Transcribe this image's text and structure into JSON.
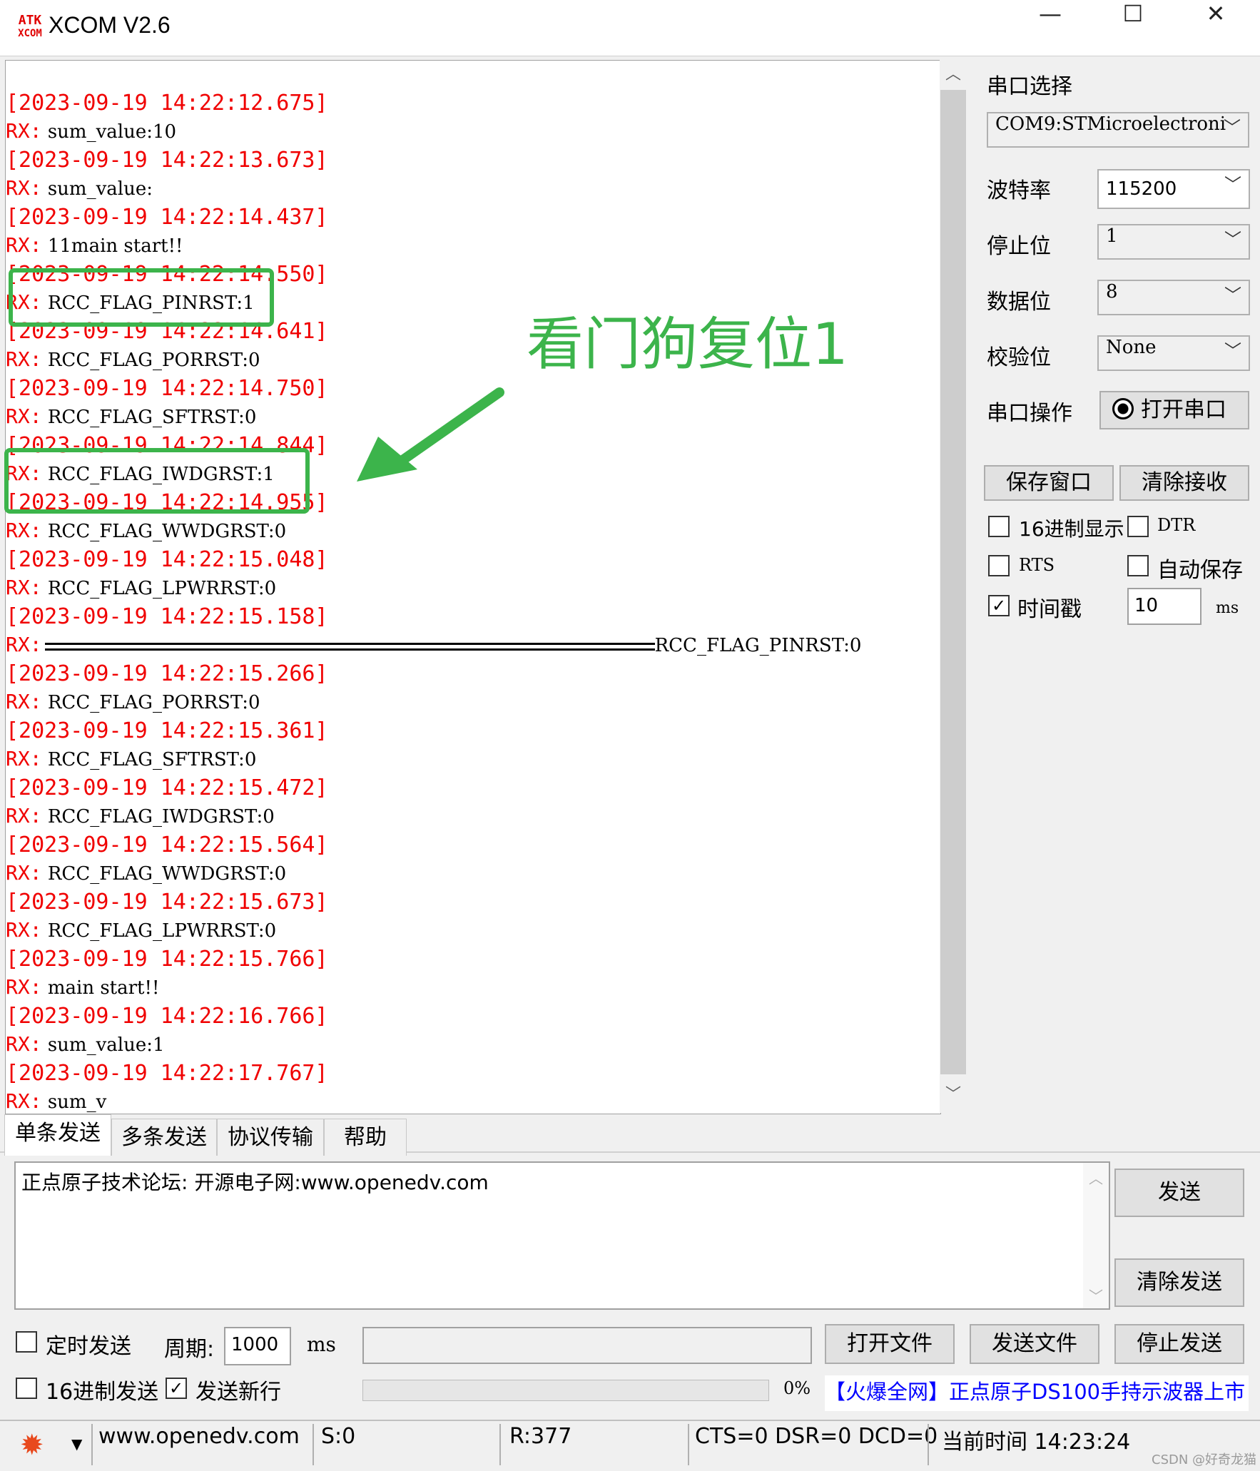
{
  "window": {
    "logo_top": "ATK",
    "logo_bottom": "XCOM",
    "title": "XCOM V2.6",
    "minimize_glyph": "—",
    "maximize_glyph": "☐",
    "close_glyph": "✕"
  },
  "receive": {
    "lines": [
      {
        "timestamp": "[2023-09-19 14:22:12.675]",
        "tag": "RX:",
        "text": " sum_value:10"
      },
      {
        "timestamp": "[2023-09-19 14:22:13.673]",
        "tag": "RX:",
        "text": " sum_value:"
      },
      {
        "timestamp": "[2023-09-19 14:22:14.437]",
        "tag": "RX:",
        "text": " 11main start!!"
      },
      {
        "timestamp": "[2023-09-19 14:22:14.550]",
        "tag": "RX:",
        "text": " RCC_FLAG_PINRST:1"
      },
      {
        "timestamp": "[2023-09-19 14:22:14.641]",
        "tag": "RX:",
        "text": " RCC_FLAG_PORRST:0"
      },
      {
        "timestamp": "[2023-09-19 14:22:14.750]",
        "tag": "RX:",
        "text": " RCC_FLAG_SFTRST:0"
      },
      {
        "timestamp": "[2023-09-19 14:22:14.844]",
        "tag": "RX:",
        "text": " RCC_FLAG_IWDGRST:1"
      },
      {
        "timestamp": "[2023-09-19 14:22:14.955]",
        "tag": "RX:",
        "text": " RCC_FLAG_WWDGRST:0"
      },
      {
        "timestamp": "[2023-09-19 14:22:15.048]",
        "tag": "RX:",
        "text": " RCC_FLAG_LPWRRST:0"
      },
      {
        "timestamp": "[2023-09-19 14:22:15.158]",
        "tag": "RX:",
        "text": "RCC_FLAG_PINRST:0",
        "separator": true
      },
      {
        "timestamp": "[2023-09-19 14:22:15.266]",
        "tag": "RX:",
        "text": " RCC_FLAG_PORRST:0"
      },
      {
        "timestamp": "[2023-09-19 14:22:15.361]",
        "tag": "RX:",
        "text": " RCC_FLAG_SFTRST:0"
      },
      {
        "timestamp": "[2023-09-19 14:22:15.472]",
        "tag": "RX:",
        "text": " RCC_FLAG_IWDGRST:0"
      },
      {
        "timestamp": "[2023-09-19 14:22:15.564]",
        "tag": "RX:",
        "text": " RCC_FLAG_WWDGRST:0"
      },
      {
        "timestamp": "[2023-09-19 14:22:15.673]",
        "tag": "RX:",
        "text": " RCC_FLAG_LPWRRST:0"
      },
      {
        "timestamp": "[2023-09-19 14:22:15.766]",
        "tag": "RX:",
        "text": " main start!!"
      },
      {
        "timestamp": "[2023-09-19 14:22:16.766]",
        "tag": "RX:",
        "text": " sum_value:1"
      },
      {
        "timestamp": "[2023-09-19 14:22:17.767]",
        "tag": "RX:",
        "text": " sum_v"
      }
    ]
  },
  "annotation": {
    "text": "看门狗复位1",
    "color": "#3cb44b"
  },
  "serial": {
    "port_label": "串口选择",
    "port_value": "COM9:STMicroelectroni",
    "baud_label": "波特率",
    "baud_value": "115200",
    "stop_label": "停止位",
    "stop_value": "1",
    "data_label": "数据位",
    "data_value": "8",
    "parity_label": "校验位",
    "parity_value": "None",
    "op_label": "串口操作",
    "open_button": "打开串口",
    "save_window": "保存窗口",
    "clear_receive": "清除接收",
    "hex_display": "16进制显示",
    "dtr": "DTR",
    "rts": "RTS",
    "auto_save": "自动保存",
    "timestamp_label": "时间戳",
    "timestamp_checked": true,
    "timestamp_interval": "10",
    "timestamp_unit": "ms"
  },
  "tabs": [
    "单条发送",
    "多条发送",
    "协议传输",
    "帮助"
  ],
  "send": {
    "text": "正点原子技术论坛: 开源电子网:www.openedv.com",
    "send_button": "发送",
    "clear_send_button": "清除发送",
    "timed_send": "定时发送",
    "period_label": "周期:",
    "period_value": "1000",
    "period_unit": "ms",
    "open_file": "打开文件",
    "send_file": "发送文件",
    "stop_send": "停止发送",
    "hex_send": "16进制发送",
    "send_newline": "发送新行",
    "newline_checked": true,
    "progress": "0%",
    "progress_value": 0,
    "ad_text": "【火爆全网】正点原子DS100手持示波器上市"
  },
  "status": {
    "url": "www.openedv.com",
    "sent": "S:0",
    "received": "R:377",
    "lines": "CTS=0 DSR=0 DCD=0",
    "time": "当前时间 14:23:24",
    "watermark": "CSDN @好奇龙猫"
  },
  "colors": {
    "timestamp": "#f00000",
    "highlight": "#3cb44b",
    "ad_link": "#0000ff"
  }
}
